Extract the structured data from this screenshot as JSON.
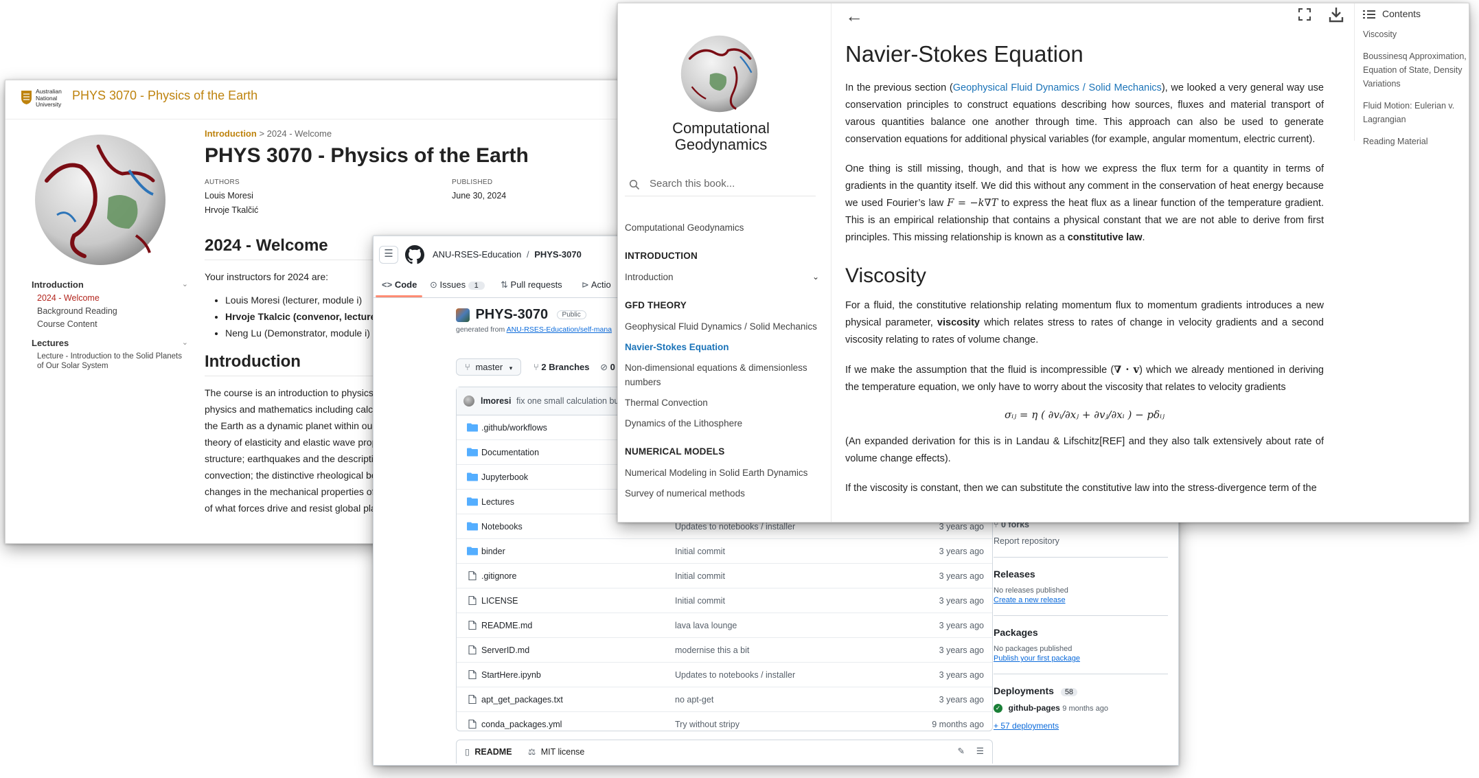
{
  "course_site": {
    "logo_text": [
      "Australian",
      "National",
      "University"
    ],
    "site_title": "PHYS 3070 - Physics of the Earth",
    "nav": [
      {
        "head": "Introduction",
        "items": [
          {
            "label": "2024 - Welcome",
            "active": true
          },
          {
            "label": "Background Reading",
            "active": false
          },
          {
            "label": "Course Content",
            "active": false
          }
        ]
      },
      {
        "head": "Lectures",
        "items": [
          {
            "label": "Lecture - Introduction to the Solid Planets of Our Solar System",
            "active": false
          }
        ]
      }
    ],
    "breadcrumb": {
      "first": "Introduction",
      "sep": ">",
      "current": "2024 - Welcome"
    },
    "title": "PHYS 3070 - Physics of the Earth",
    "authors_label": "AUTHORS",
    "authors": [
      "Louis Moresi",
      "Hrvoje Tkalčić"
    ],
    "published_label": "PUBLISHED",
    "published": "June 30, 2024",
    "welcome_heading": "2024 - Welcome",
    "instructors_intro": "Your instructors for 2024 are:",
    "instructors": [
      {
        "text": "Louis Moresi (lecturer, module i)",
        "bold": false
      },
      {
        "text": "Hrvoje Tkalcic (convenor, lecture",
        "bold": true
      },
      {
        "text": "Neng Lu (Demonstrator, module i)",
        "bold": false
      }
    ],
    "intro_heading": "Introduction",
    "intro_lines": [
      "The course is an introduction to physics",
      "physics and mathematics including calcu",
      "the Earth as a dynamic planet within our",
      "theory of elasticity and elastic wave prop",
      "structure; earthquakes and the descriptic",
      "convection; the distinctive rheological be",
      "changes in the mechanical properties of",
      "of what forces drive and resist global pla"
    ]
  },
  "github": {
    "owner": "ANU-RSES-Education",
    "sep": "/",
    "repo": "PHYS-3070",
    "tabs": {
      "code": "Code",
      "issues": "Issues",
      "issues_count": "1",
      "pulls": "Pull requests",
      "actions": "Actio"
    },
    "repo_name": "PHYS-3070",
    "visibility": "Public",
    "generated_prefix": "generated from",
    "generated_link": "ANU-RSES-Education/self-mana",
    "branch": "master",
    "branches": "2 Branches",
    "tags": "0",
    "commit_user": "lmoresi",
    "commit_msg": "fix one small calculation bu",
    "files": [
      {
        "type": "dir",
        "name": ".github/workflows",
        "msg": "",
        "date": ""
      },
      {
        "type": "dir",
        "name": "Documentation",
        "msg": "",
        "date": ""
      },
      {
        "type": "dir",
        "name": "Jupyterbook",
        "msg": "",
        "date": ""
      },
      {
        "type": "dir",
        "name": "Lectures",
        "msg": "",
        "date": ""
      },
      {
        "type": "dir",
        "name": "Notebooks",
        "msg": "Updates to notebooks / installer",
        "date": "3 years ago"
      },
      {
        "type": "dir",
        "name": "binder",
        "msg": "Initial commit",
        "date": "3 years ago"
      },
      {
        "type": "file",
        "name": ".gitignore",
        "msg": "Initial commit",
        "date": "3 years ago"
      },
      {
        "type": "file",
        "name": "LICENSE",
        "msg": "Initial commit",
        "date": "3 years ago"
      },
      {
        "type": "file",
        "name": "README.md",
        "msg": "lava lava lounge",
        "date": "3 years ago"
      },
      {
        "type": "file",
        "name": "ServerID.md",
        "msg": "modernise this a bit",
        "date": "3 years ago"
      },
      {
        "type": "file",
        "name": "StartHere.ipynb",
        "msg": "Updates to notebooks / installer",
        "date": "3 years ago"
      },
      {
        "type": "file",
        "name": "apt_get_packages.txt",
        "msg": "no apt-get",
        "date": "3 years ago"
      },
      {
        "type": "file",
        "name": "conda_packages.yml",
        "msg": "Try without stripy",
        "date": "9 months ago"
      }
    ],
    "readme_tab": "README",
    "license_tab": "MIT license",
    "forks": "0 forks",
    "report": "Report repository",
    "releases_title": "Releases",
    "releases_none": "No releases published",
    "releases_link": "Create a new release",
    "packages_title": "Packages",
    "packages_none": "No packages published",
    "packages_link": "Publish your first package",
    "deployments_title": "Deployments",
    "deployments_count": "58",
    "deploy_env": "github-pages",
    "deploy_when": "9 months ago",
    "deploy_more": "+ 57 deployments",
    "colors": {
      "accent": "#0969da",
      "tab_underline": "#fd8c73",
      "success": "#1a7f37"
    }
  },
  "book": {
    "title_line1": "Computational",
    "title_line2": "Geodynamics",
    "search_placeholder": "Search this book...",
    "toc": [
      {
        "kind": "item",
        "label": "Computational Geodynamics"
      },
      {
        "kind": "caption",
        "label": "INTRODUCTION"
      },
      {
        "kind": "item",
        "label": "Introduction",
        "chevron": true
      },
      {
        "kind": "caption",
        "label": "GFD THEORY"
      },
      {
        "kind": "item",
        "label": "Geophysical Fluid Dynamics / Solid Mechanics"
      },
      {
        "kind": "item",
        "label": "Navier-Stokes Equation",
        "active": true
      },
      {
        "kind": "item",
        "label": "Non-dimensional equations & dimensionless numbers"
      },
      {
        "kind": "item",
        "label": "Thermal Convection"
      },
      {
        "kind": "item",
        "label": "Dynamics of the Lithosphere"
      },
      {
        "kind": "caption",
        "label": "NUMERICAL MODELS"
      },
      {
        "kind": "item",
        "label": "Numerical Modeling in Solid Earth Dynamics"
      },
      {
        "kind": "item",
        "label": "Survey of numerical methods"
      }
    ],
    "page_title": "Navier-Stokes Equation",
    "p1_before": "In the previous section (",
    "p1_link": "Geophysical Fluid Dynamics / Solid Mechanics",
    "p1_after": "), we looked a very general way use conservation principles to construct equations describing how sources, fluxes and material transport of varous quantities balance one another through time. This approach can also be used to generate conservation equations for additional physical variables (for example, angular momentum, electric current).",
    "p2_before": "One thing is still missing, though, and that is how we express the flux term for a quantity in terms of gradients in the quantity itself. We did this without any comment in the conservation of heat energy because we used Fourier’s law ",
    "p2_math": "F = −k∇T",
    "p2_after": " to express the heat flux as a linear function of the temperature gradient. This is an empirical relationship that contains a physical constant that we are not able to derive from first principles. This missing relationship is known as a ",
    "p2_bold": "constitutive law",
    "p2_end": ".",
    "h_visc": "Viscosity",
    "p3_before": "For a fluid, the constitutive relationship relating momentum flux to momentum gradients introduces a new physical parameter, ",
    "p3_bold": "viscosity",
    "p3_after": " which relates stress to rates of change in velocity gradients and a second viscosity relating to rates of volume change.",
    "p4_before": "If we make the assumption that the fluid is incompressible (",
    "p4_math": "∇ · v",
    "p4_after": ") which we already mentioned in deriving the temperature equation, we only have to worry about the viscosity that relates to velocity gradients",
    "equation": "σᵢⱼ = η ( ∂vᵢ/∂xⱼ + ∂vⱼ/∂xᵢ ) − pδᵢⱼ",
    "p5": "(An expanded derivation for this is in Landau & Lifschitz[REF] and they also talk extensively about rate of volume change effects).",
    "p6": "If the viscosity is constant, then we can substitute the constitutive law into the stress-divergence term of the",
    "contents_label": "Contents",
    "contents": [
      "Viscosity",
      "Boussinesq Approximation, Equation of State, Density Variations",
      "Fluid Motion: Eulerian v. Lagrangian",
      "Reading Material"
    ]
  }
}
